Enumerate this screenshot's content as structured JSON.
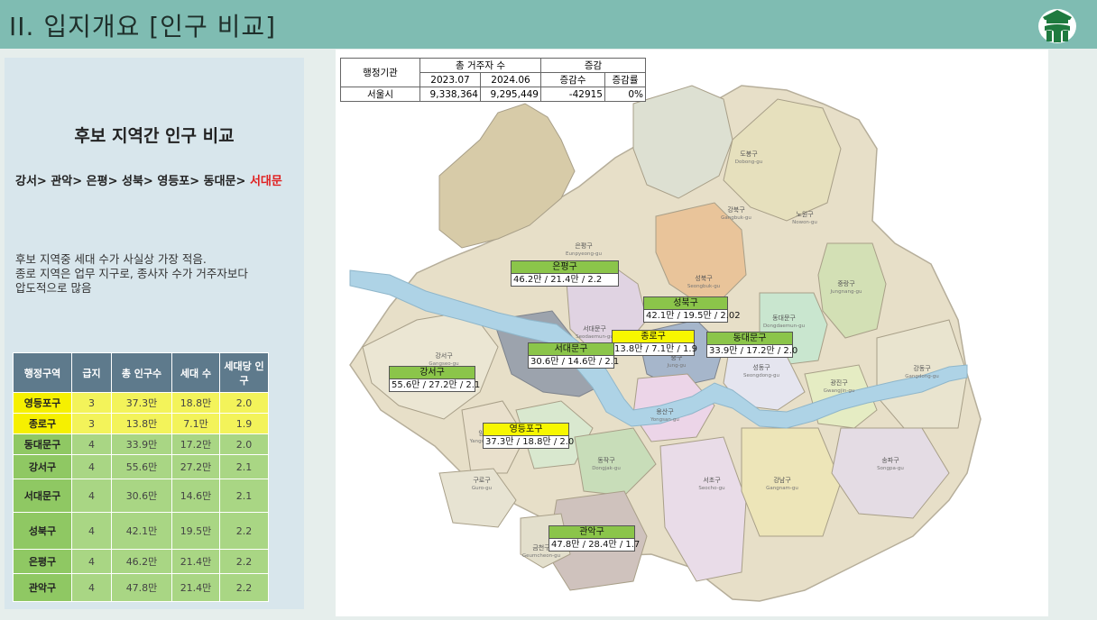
{
  "header": {
    "title": "II. 입지개요 [인구 비교]"
  },
  "left_panel": {
    "title": "후보 지역간 인구 비교",
    "ranking_prefix": "강서> 관악> 은평> 성북> 영등포> 동대문> ",
    "ranking_highlight": "서대문",
    "desc_lines": [
      "후보 지역중 세대 수가 사실상 가장 적음.",
      "종로 지역은 업무 지구로, 종사자 수가 거주자보다",
      "압도적으로 많음"
    ],
    "table": {
      "headers": [
        "행정구역",
        "급지",
        "총 인구수",
        "세대 수",
        "세대당 인구"
      ],
      "rows": [
        {
          "district": "영등포구",
          "grade": "3",
          "population": "37.3만",
          "households": "18.8만",
          "per_household": "2.0",
          "style": "yellow"
        },
        {
          "district": "종로구",
          "grade": "3",
          "population": "13.8만",
          "households": "7.1만",
          "per_household": "1.9",
          "style": "yellow"
        },
        {
          "district": "동대문구",
          "grade": "4",
          "population": "33.9만",
          "households": "17.2만",
          "per_household": "2.0",
          "style": "green"
        },
        {
          "district": "강서구",
          "grade": "4",
          "population": "55.6만",
          "households": "27.2만",
          "per_household": "2.1",
          "style": "green"
        },
        {
          "district": "서대문구",
          "grade": "4",
          "population": "30.6만",
          "households": "14.6만",
          "per_household": "2.1",
          "style": "green"
        },
        {
          "district": "성북구",
          "grade": "4",
          "population": "42.1만",
          "households": "19.5만",
          "per_household": "2.2",
          "style": "green"
        },
        {
          "district": "은평구",
          "grade": "4",
          "population": "46.2만",
          "households": "21.4만",
          "per_household": "2.2",
          "style": "green"
        },
        {
          "district": "관악구",
          "grade": "4",
          "population": "47.8만",
          "households": "21.4만",
          "per_household": "2.2",
          "style": "green"
        }
      ]
    }
  },
  "pop_table": {
    "col_admin": "행정기관",
    "col_total": "총 거주자 수",
    "col_change": "증감",
    "date1": "2023.07",
    "date2": "2024.06",
    "change_count": "증감수",
    "change_rate": "증감률",
    "row_name": "서울시",
    "value1": "9,338,364",
    "value2": "9,295,449",
    "delta": "-42915",
    "rate": "0%"
  },
  "map": {
    "labels": [
      {
        "name": "은평구",
        "value": "46.2만 / 21.4만 / 2.2",
        "style": "green"
      },
      {
        "name": "성북구",
        "value": "42.1만 / 19.5만 / 2.02",
        "style": "green"
      },
      {
        "name": "종로구",
        "value": "13.8만 / 7.1만 / 1.9",
        "style": "yellow"
      },
      {
        "name": "동대문구",
        "value": "33.9만 / 17.2만 / 2.0",
        "style": "green"
      },
      {
        "name": "서대문구",
        "value": "30.6만 / 14.6만 / 2.1",
        "style": "green"
      },
      {
        "name": "강서구",
        "value": "55.6만 / 27.2만 / 2.1",
        "style": "green"
      },
      {
        "name": "영등포구",
        "value": "37.3만 / 18.8만 / 2.0",
        "style": "yellow"
      },
      {
        "name": "관악구",
        "value": "47.8만 / 28.4만 / 1.7",
        "style": "green"
      }
    ],
    "districts": [
      {
        "ko": "도봉구",
        "en": "Dobong-gu"
      },
      {
        "ko": "강북구",
        "en": "Gangbuk-gu"
      },
      {
        "ko": "노원구",
        "en": "Nowon-gu"
      },
      {
        "ko": "은평구",
        "en": "Eunpyeong-gu"
      },
      {
        "ko": "성북구",
        "en": "Seongbuk-gu"
      },
      {
        "ko": "중랑구",
        "en": "Jungnang-gu"
      },
      {
        "ko": "동대문구",
        "en": "Dongdaemun-gu"
      },
      {
        "ko": "서대문구",
        "en": "Seodaemun-gu"
      },
      {
        "ko": "강서구",
        "en": "Gangseo-gu"
      },
      {
        "ko": "마포구",
        "en": "Mapo-gu"
      },
      {
        "ko": "중구",
        "en": "Jung-gu"
      },
      {
        "ko": "성동구",
        "en": "Seongdong-gu"
      },
      {
        "ko": "광진구",
        "en": "Gwangjin-gu"
      },
      {
        "ko": "용산구",
        "en": "Yongsan-gu"
      },
      {
        "ko": "강동구",
        "en": "Gangdong-gu"
      },
      {
        "ko": "양천구",
        "en": "Yangcheon-gu"
      },
      {
        "ko": "구로구",
        "en": "Guro-gu"
      },
      {
        "ko": "동작구",
        "en": "Dongjak-gu"
      },
      {
        "ko": "송파구",
        "en": "Songpa-gu"
      },
      {
        "ko": "서초구",
        "en": "Seocho-gu"
      },
      {
        "ko": "강남구",
        "en": "Gangnam-gu"
      },
      {
        "ko": "금천구",
        "en": "Geumcheon-gu"
      }
    ]
  }
}
